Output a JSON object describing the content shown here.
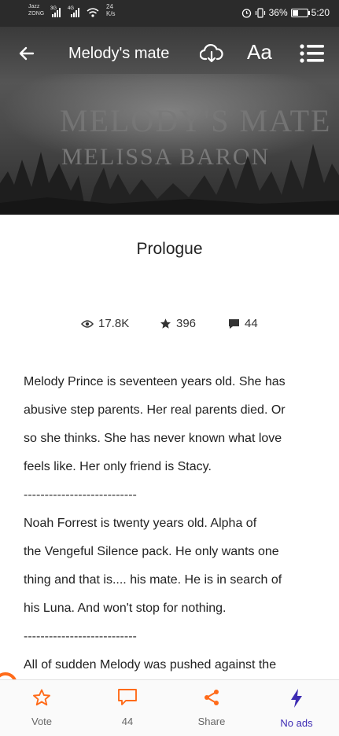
{
  "status_bar": {
    "carrier_1": "Jazz",
    "carrier_2": "ZONG",
    "net_1": "3G",
    "net_2": "4G",
    "speed_value": "24",
    "speed_unit": "K/s",
    "battery": "36%",
    "time": "5:20"
  },
  "header": {
    "title": "Melody's mate",
    "font_button": "Aa",
    "cover_title": "MELODY'S MATE",
    "cover_author": "MELISSA BARON"
  },
  "chapter": {
    "title": "Prologue",
    "views": "17.8K",
    "votes": "396",
    "comments": "44"
  },
  "story": {
    "lines": [
      "Melody Prince is seventeen years old. She has",
      "abusive step parents. Her real parents died. Or",
      "so she thinks. She has never known what love",
      "feels like. Her only friend is Stacy.",
      "---------------------------",
      "Noah Forrest is twenty years old. Alpha of",
      "the Vengeful Silence pack. He only wants one",
      "thing and that is.... his mate. He is in search of",
      "his Luna. And won't stop for nothing.",
      "---------------------------",
      "All of sudden Melody was pushed against the"
    ]
  },
  "bottom_nav": {
    "vote": "Vote",
    "comments": "44",
    "share": "Share",
    "no_ads": "No ads"
  },
  "colors": {
    "accent": "#ff6b1a",
    "no_ads": "#3d2bb3"
  }
}
